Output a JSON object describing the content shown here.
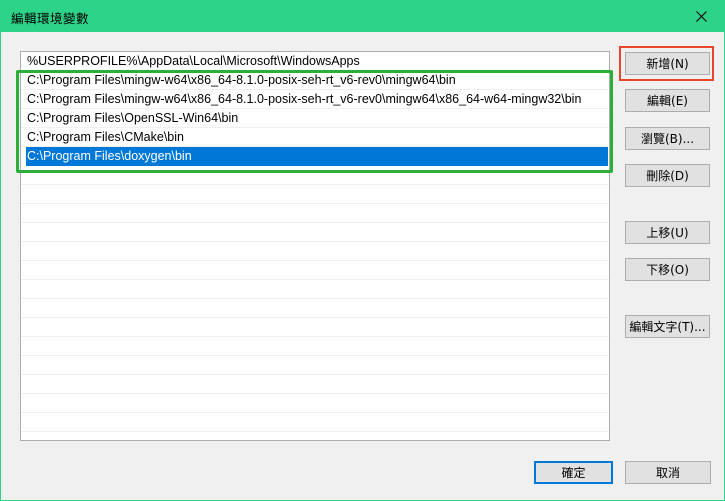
{
  "window": {
    "title": "編輯環境變數",
    "close_glyph": "✕"
  },
  "paths": [
    "%USERPROFILE%\\AppData\\Local\\Microsoft\\WindowsApps",
    "C:\\Program Files\\mingw-w64\\x86_64-8.1.0-posix-seh-rt_v6-rev0\\mingw64\\bin",
    "C:\\Program Files\\mingw-w64\\x86_64-8.1.0-posix-seh-rt_v6-rev0\\mingw64\\x86_64-w64-mingw32\\bin",
    "C:\\Program Files\\OpenSSL-Win64\\bin",
    "C:\\Program Files\\CMake\\bin",
    "C:\\Program Files\\doxygen\\bin"
  ],
  "selected_index": 5,
  "buttons": {
    "new": "新增(N)",
    "edit": "編輯(E)",
    "browse": "瀏覽(B)...",
    "delete": "刪除(D)",
    "move_up": "上移(U)",
    "move_down": "下移(O)",
    "edit_text": "編輯文字(T)...",
    "ok": "確定",
    "cancel": "取消"
  },
  "colors": {
    "titlebar": "#2ed38a",
    "selection": "#0078d7",
    "highlight_red": "#e8452a",
    "highlight_green": "#2dae3a"
  }
}
